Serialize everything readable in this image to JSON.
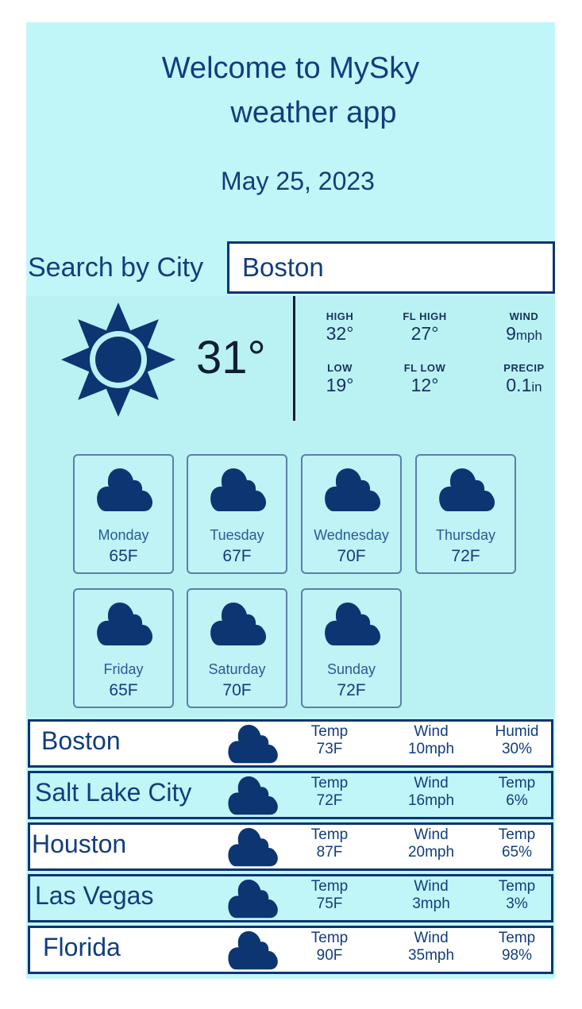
{
  "header": {
    "welcome_line1": "Welcome to MySky",
    "welcome_line2": "weather app",
    "date": "May 25, 2023"
  },
  "search": {
    "label": "Search by City",
    "value": "Boston"
  },
  "current": {
    "icon": "sun-icon",
    "temperature": "31°",
    "stats": [
      {
        "label": "HIGH",
        "value": "32°",
        "unit": ""
      },
      {
        "label": "FL HIGH",
        "value": "27°",
        "unit": ""
      },
      {
        "label": "WIND",
        "value": "9",
        "unit": "mph"
      },
      {
        "label": "LOW",
        "value": "19°",
        "unit": ""
      },
      {
        "label": "FL LOW",
        "value": "12°",
        "unit": ""
      },
      {
        "label": "PRECIP",
        "value": "0.1",
        "unit": "in"
      }
    ]
  },
  "forecast": [
    {
      "day": "Monday",
      "temp": "65F",
      "icon": "cloud-icon"
    },
    {
      "day": "Tuesday",
      "temp": "67F",
      "icon": "cloud-icon"
    },
    {
      "day": "Wednesday",
      "temp": "70F",
      "icon": "cloud-icon"
    },
    {
      "day": "Thursday",
      "temp": "72F",
      "icon": "cloud-icon"
    },
    {
      "day": "Friday",
      "temp": "65F",
      "icon": "cloud-icon"
    },
    {
      "day": "Saturday",
      "temp": "70F",
      "icon": "cloud-icon"
    },
    {
      "day": "Sunday",
      "temp": "72F",
      "icon": "cloud-icon"
    }
  ],
  "cities": [
    {
      "name": "Boston",
      "icon": "cloud-icon",
      "c1_label": "Temp",
      "c1_value": "73F",
      "c2_label": "Wind",
      "c2_value": "10mph",
      "c3_label": "Humid",
      "c3_value": "30%"
    },
    {
      "name": "Salt Lake City",
      "icon": "cloud-icon",
      "c1_label": "Temp",
      "c1_value": "72F",
      "c2_label": "Wind",
      "c2_value": "16mph",
      "c3_label": "Temp",
      "c3_value": "6%"
    },
    {
      "name": "Houston",
      "icon": "cloud-icon",
      "c1_label": "Temp",
      "c1_value": "87F",
      "c2_label": "Wind",
      "c2_value": "20mph",
      "c3_label": "Temp",
      "c3_value": "65%"
    },
    {
      "name": "Las Vegas",
      "icon": "cloud-icon",
      "c1_label": "Temp",
      "c1_value": "75F",
      "c2_label": "Wind",
      "c2_value": "3mph",
      "c3_label": "Temp",
      "c3_value": "3%"
    },
    {
      "name": "Florida",
      "icon": "cloud-icon",
      "c1_label": "Temp",
      "c1_value": "90F",
      "c2_label": "Wind",
      "c2_value": "35mph",
      "c3_label": "Temp",
      "c3_value": "98%"
    }
  ],
  "colors": {
    "primary": "#0d3572",
    "panel": "#c1f6f8",
    "card_border": "#5b7fa8"
  }
}
